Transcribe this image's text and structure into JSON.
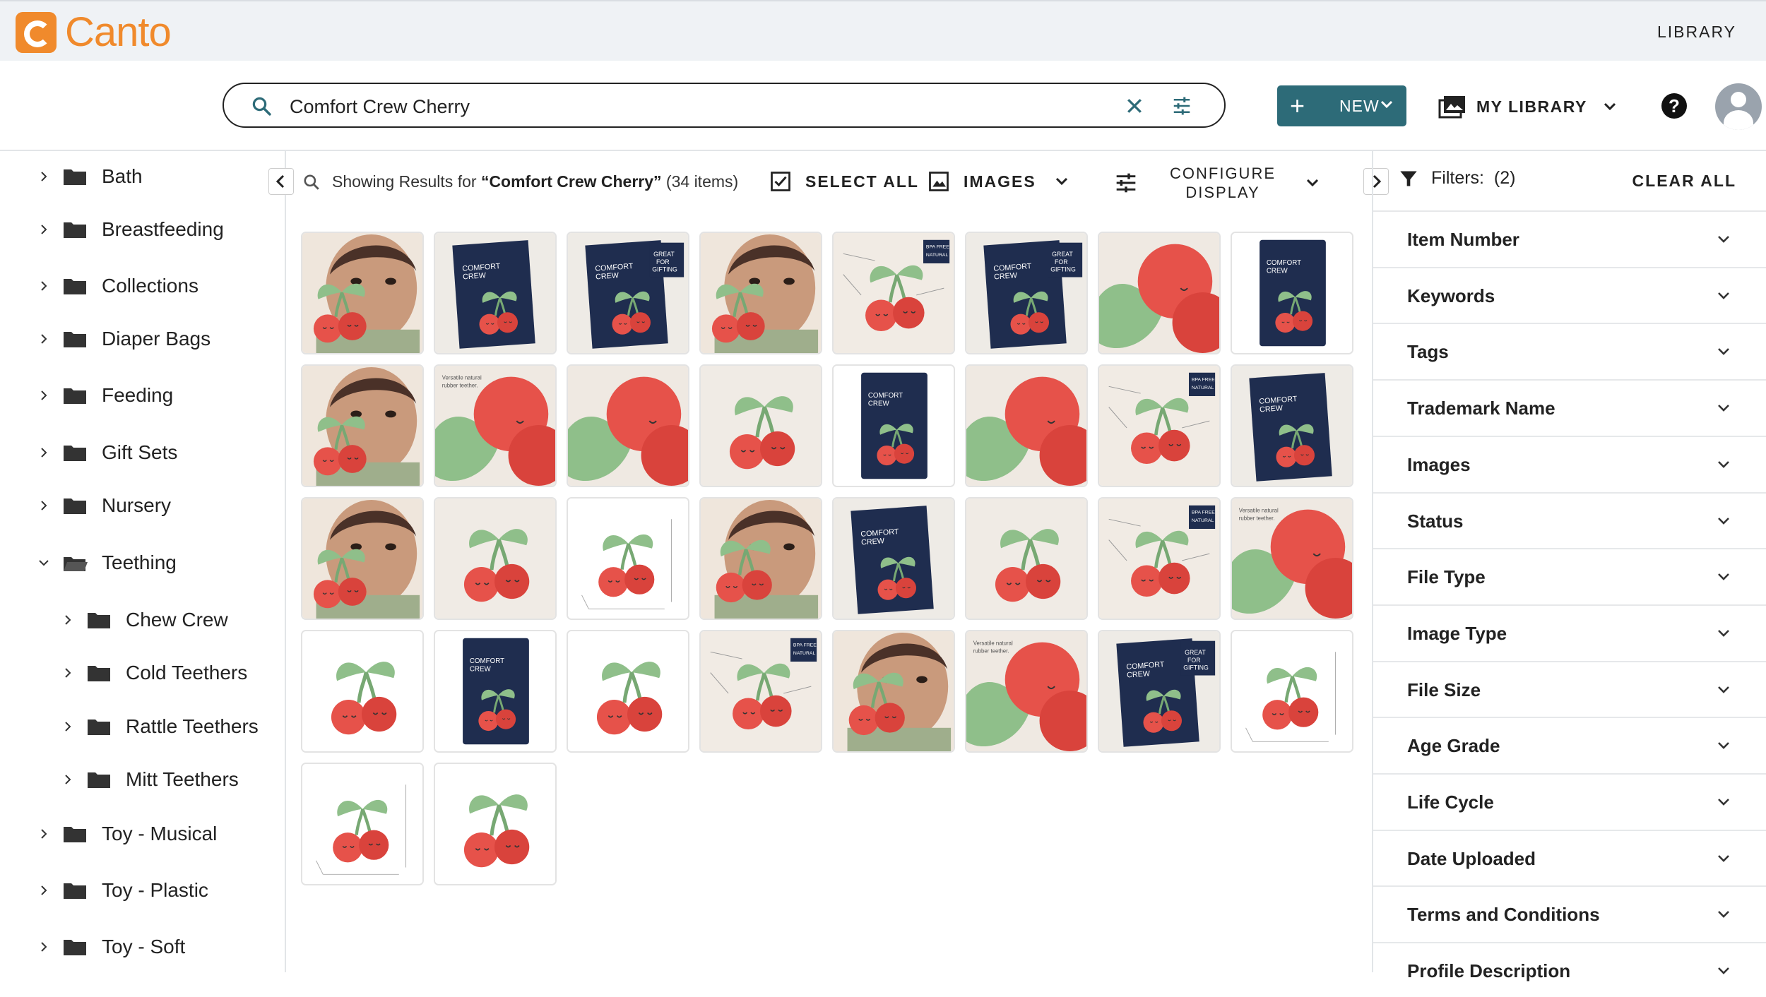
{
  "brand": {
    "name": "Canto",
    "color": "#f08a2c"
  },
  "header": {
    "library_link": "LIBRARY"
  },
  "search": {
    "query": "Comfort Crew Cherry"
  },
  "actions": {
    "new_label": "NEW",
    "my_library_label": "MY LIBRARY",
    "accent": "#2d6b78"
  },
  "sidebar": {
    "items": [
      {
        "label": "Bath",
        "level": 0,
        "expanded": false
      },
      {
        "label": "Breastfeeding",
        "level": 0,
        "expanded": false
      },
      {
        "label": "Collections",
        "level": 0,
        "expanded": false
      },
      {
        "label": "Diaper Bags",
        "level": 0,
        "expanded": false
      },
      {
        "label": "Feeding",
        "level": 0,
        "expanded": false
      },
      {
        "label": "Gift Sets",
        "level": 0,
        "expanded": false
      },
      {
        "label": "Nursery",
        "level": 0,
        "expanded": false
      },
      {
        "label": "Teething",
        "level": 0,
        "expanded": true
      },
      {
        "label": "Chew Crew",
        "level": 1,
        "expanded": false
      },
      {
        "label": "Cold Teethers",
        "level": 1,
        "expanded": false
      },
      {
        "label": "Rattle Teethers",
        "level": 1,
        "expanded": false
      },
      {
        "label": "Mitt Teethers",
        "level": 1,
        "expanded": false
      },
      {
        "label": "Toy - Musical",
        "level": 0,
        "expanded": false
      },
      {
        "label": "Toy - Plastic",
        "level": 0,
        "expanded": false
      },
      {
        "label": "Toy - Soft",
        "level": 0,
        "expanded": false
      }
    ]
  },
  "toolbar": {
    "results_prefix": "Showing Results for ",
    "results_query": "“Comfort Crew Cherry”",
    "results_count": " (34 items)",
    "select_all": "SELECT ALL",
    "images": "IMAGES",
    "configure_line1": "CONFIGURE",
    "configure_line2": "DISPLAY"
  },
  "filters": {
    "title": "Filters:",
    "count": "(2)",
    "clear_all": "CLEAR ALL",
    "items": [
      "Item Number",
      "Keywords",
      "Tags",
      "Trademark Name",
      "Images",
      "Status",
      "File Type",
      "Image Type",
      "File Size",
      "Age Grade",
      "Life Cycle",
      "Date Uploaded",
      "Terms and Conditions",
      "Profile Description"
    ]
  },
  "grid": {
    "thumbnails": [
      {
        "kind": "baby",
        "box_text": ""
      },
      {
        "kind": "box",
        "box_text": "COMFORT CREW"
      },
      {
        "kind": "box-gift",
        "box_text": "COMFORT CREW",
        "badge": "GREAT FOR GIFTING"
      },
      {
        "kind": "baby",
        "box_text": ""
      },
      {
        "kind": "infographic",
        "badge": "BPA FREE NATURAL RUBBER"
      },
      {
        "kind": "box-gift",
        "box_text": "COMFORT CREW",
        "badge": "GREAT FOR GIFTING"
      },
      {
        "kind": "closeup"
      },
      {
        "kind": "card",
        "box_text": "COMFORT CREW"
      },
      {
        "kind": "baby"
      },
      {
        "kind": "closeup-text",
        "note": "Versatile natural rubber teether. Ideal for front, side and back gums."
      },
      {
        "kind": "closeup"
      },
      {
        "kind": "cherry-beige"
      },
      {
        "kind": "card",
        "box_text": "COMFORT CREW"
      },
      {
        "kind": "closeup"
      },
      {
        "kind": "infographic",
        "badge": "BPA FREE NATURAL RUBBER"
      },
      {
        "kind": "box",
        "box_text": "COMFORT CREW"
      },
      {
        "kind": "baby"
      },
      {
        "kind": "cherry-beige"
      },
      {
        "kind": "dimension"
      },
      {
        "kind": "baby-bite"
      },
      {
        "kind": "box",
        "box_text": "COMFORT CREW"
      },
      {
        "kind": "cherry-beige"
      },
      {
        "kind": "infographic",
        "badge": "BPA FREE NATURAL RUBBER"
      },
      {
        "kind": "closeup-text",
        "note": "Versatile natural rubber teether. Ideal for front, side and back gums."
      },
      {
        "kind": "cherry-white"
      },
      {
        "kind": "card",
        "box_text": "COMFORT CREW"
      },
      {
        "kind": "cherry-white"
      },
      {
        "kind": "infographic",
        "badge": "BPA FREE NATURAL RUBBER"
      },
      {
        "kind": "baby-bite"
      },
      {
        "kind": "closeup-text",
        "note": "Versatile natural rubber teether. Ideal for front, side and back gums."
      },
      {
        "kind": "box-gift",
        "box_text": "COMFORT CREW",
        "badge": "GREAT FOR GIFTING"
      },
      {
        "kind": "dimension"
      },
      {
        "kind": "dimension"
      },
      {
        "kind": "cherry-white"
      }
    ]
  }
}
